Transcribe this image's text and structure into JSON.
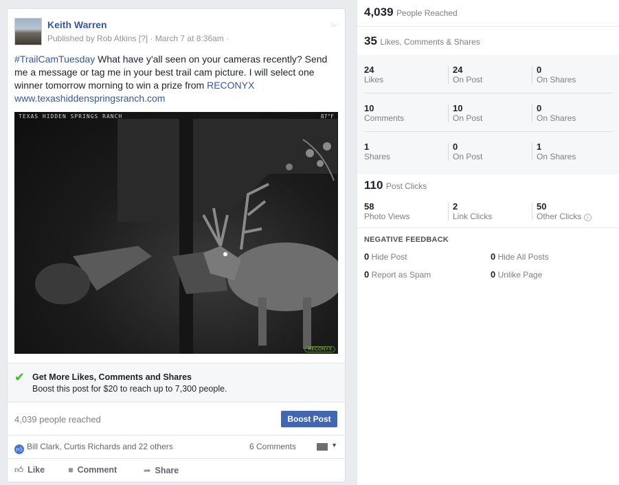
{
  "post": {
    "author": "Keith Warren",
    "meta": "Published by Rob Atkins [?] · March 7 at 8:36am ·",
    "text_part1": "#TrailCamTuesday",
    "text_part2": " What have y'all seen on your cameras recently? Send me a message or tag me in your best trail cam picture. I will select one winner tomorrow morning to win a prize from ",
    "text_part3": "RECONYX",
    "text_link": "www.texashiddenspringsranch.com",
    "photo_caption": "TEXAS HIDDEN SPRINGS RANCH",
    "photo_temp": "87°F",
    "photo_brand": "RECONYX"
  },
  "boost_banner": {
    "title": "Get More Likes, Comments and Shares",
    "subtitle": "Boost this post for $20 to reach up to 7,300 people."
  },
  "reach_footer": {
    "reached_text": "4,039 people reached",
    "boost_button": "Boost Post"
  },
  "social": {
    "likers": "Bill Clark, Curtis Richards and 22 others",
    "comments": "6 Comments"
  },
  "actions": [
    {
      "label": "Like"
    },
    {
      "label": "Comment"
    },
    {
      "label": "Share"
    }
  ],
  "insights": {
    "reach_num": "4,039",
    "reach_label": "People Reached",
    "engagement_num": "35",
    "engagement_label": "Likes, Comments & Shares",
    "grid": [
      [
        {
          "num": "24",
          "label": "Likes"
        },
        {
          "num": "24",
          "label": "On Post"
        },
        {
          "num": "0",
          "label": "On Shares"
        }
      ],
      [
        {
          "num": "10",
          "label": "Comments"
        },
        {
          "num": "10",
          "label": "On Post"
        },
        {
          "num": "0",
          "label": "On Shares"
        }
      ],
      [
        {
          "num": "1",
          "label": "Shares"
        },
        {
          "num": "0",
          "label": "On Post"
        },
        {
          "num": "1",
          "label": "On Shares"
        }
      ]
    ],
    "clicks_num": "110",
    "clicks_label": "Post Clicks",
    "clicks": [
      {
        "num": "58",
        "label": "Photo Views"
      },
      {
        "num": "2",
        "label": "Link Clicks"
      },
      {
        "num": "50",
        "label": "Other Clicks"
      }
    ],
    "negative_title": "NEGATIVE FEEDBACK",
    "negative": [
      {
        "num": "0",
        "label": "Hide Post"
      },
      {
        "num": "0",
        "label": "Hide All Posts"
      },
      {
        "num": "0",
        "label": "Report as Spam"
      },
      {
        "num": "0",
        "label": "Unlike Page"
      }
    ]
  }
}
